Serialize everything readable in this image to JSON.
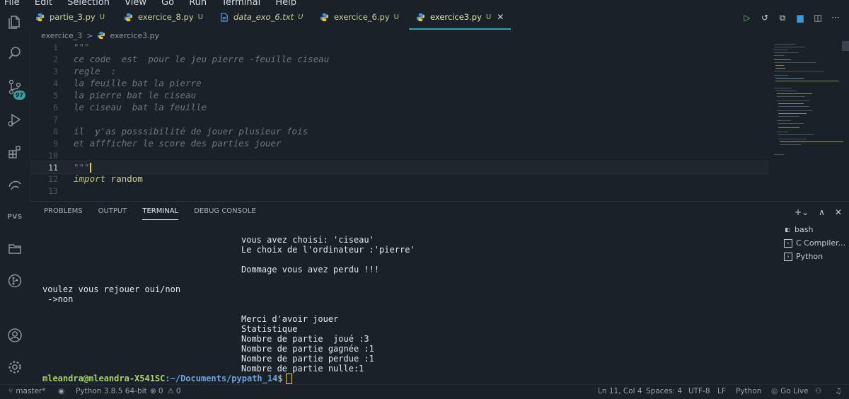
{
  "menu": [
    "File",
    "Edit",
    "Selection",
    "View",
    "Go",
    "Run",
    "Terminal",
    "Help"
  ],
  "tabs": [
    {
      "label": "partie_3.py",
      "status": "U"
    },
    {
      "label": "exercice_8.py",
      "status": "U"
    },
    {
      "label": "data_exo_6.txt",
      "status": "U"
    },
    {
      "label": "exercice_6.py",
      "status": "U"
    },
    {
      "label": "exercice3.py",
      "status": "U"
    }
  ],
  "activity_badge": "97",
  "activity_pvs": "PVS",
  "breadcrumb": {
    "folder": "exercice_3",
    "sep": ">",
    "file": "exercice3.py"
  },
  "editor": {
    "lines": [
      {
        "n": "1",
        "text": "\"\"\""
      },
      {
        "n": "2",
        "text": "ce code  est  pour le jeu pierre -feuille ciseau"
      },
      {
        "n": "3",
        "text": "regle  :"
      },
      {
        "n": "4",
        "text": "la feuille bat la pierre"
      },
      {
        "n": "5",
        "text": "la pierre bat le ciseau"
      },
      {
        "n": "6",
        "text": "le ciseau  bat la feuille"
      },
      {
        "n": "7",
        "text": ""
      },
      {
        "n": "8",
        "text": "il  y'as posssibilité de jouer plusieur fois"
      },
      {
        "n": "9",
        "text": "et affficher le score des parties jouer"
      },
      {
        "n": "10",
        "text": ""
      },
      {
        "n": "11",
        "text": "\"\"\""
      },
      {
        "n": "12",
        "kw": "import",
        "id": " random"
      },
      {
        "n": "13",
        "text": ""
      }
    ]
  },
  "panel": {
    "tabs": [
      "PROBLEMS",
      "OUTPUT",
      "TERMINAL",
      "DEBUG CONSOLE"
    ],
    "terminal_lines": [
      "vous avez choisi: 'ciseau'",
      "Le choix de l'ordinateur :'pierre'",
      "Dommage vous avez perdu !!!",
      "voulez vous rejouer oui/non",
      " ->non",
      "Merci d'avoir jouer",
      "Statistique",
      "Nombre de partie  joué :3",
      "Nombre de partie gagnée :1",
      "Nombre de partie perdue :1",
      "Nombre de partie nulle:1"
    ],
    "prompt_user": "mleandra@mleandra-X541SC",
    "prompt_path": ":~/Documents/pypath_14",
    "prompt_end": "$",
    "terminals": [
      "bash",
      "C Compiler...",
      "Python"
    ]
  },
  "status": {
    "branch": "master*",
    "python": "Python 3.8.5 64-bit",
    "errors": "0",
    "warnings": "0",
    "position": "Ln 11, Col 4",
    "spaces": "Spaces: 4",
    "encoding": "UTF-8",
    "eol": "LF",
    "language": "Python",
    "golive": "Go Live"
  }
}
